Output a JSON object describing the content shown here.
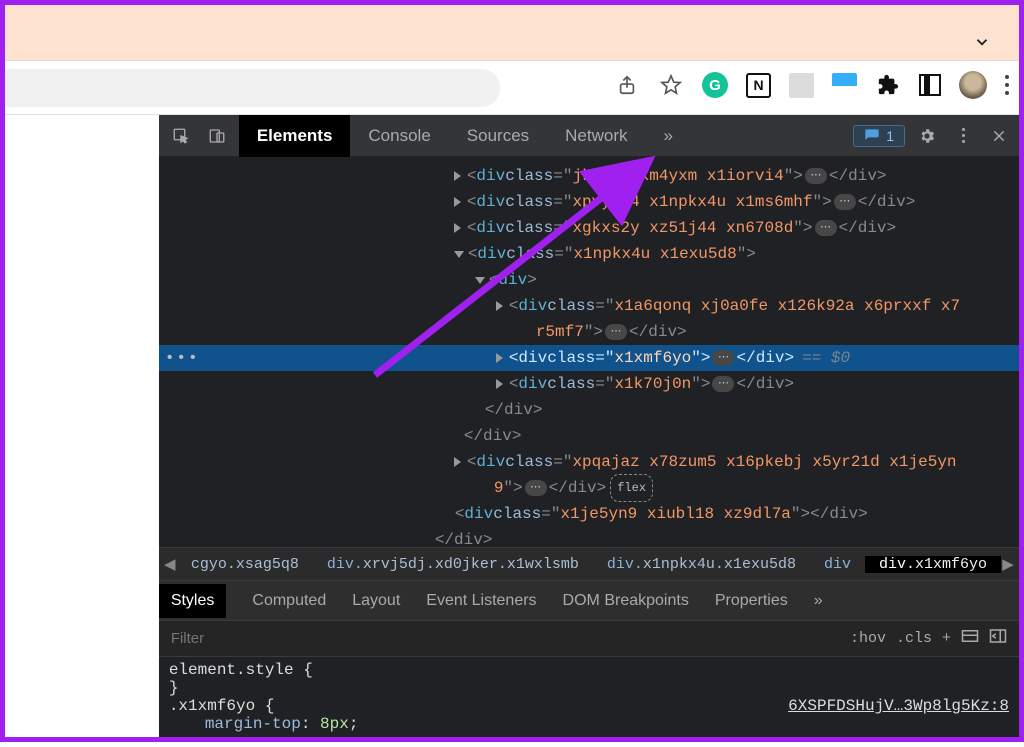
{
  "banner": {},
  "toolbar": {
    "notion_letter": "N",
    "green_letter": "G"
  },
  "devtools": {
    "tabs": [
      "Elements",
      "Console",
      "Sources",
      "Network"
    ],
    "issues_count": "1",
    "dom_lines": [
      {
        "indent": 295,
        "caret": "r",
        "pre": "<div class=\"",
        "val": "jkxs2y xm4yxm x1iorvi4",
        "post": "\">",
        "ell": true,
        "close": "</div>"
      },
      {
        "indent": 295,
        "caret": "r",
        "pre": "<div class=\"",
        "val": "xpvyfi4 x1npkx4u x1ms6mhf",
        "post": "\">",
        "ell": true,
        "close": "</div>"
      },
      {
        "indent": 295,
        "caret": "r",
        "pre": "<div class=\"",
        "val": "xgkxs2y xz51j44 xn6708d",
        "post": "\">",
        "ell": true,
        "close": "</div>"
      },
      {
        "indent": 295,
        "caret": "d",
        "pre": "<div class=\"",
        "val": "x1npkx4u x1exu5d8",
        "post": "\">",
        "close": ""
      },
      {
        "indent": 316,
        "caret": "d",
        "pre": "<div>",
        "val": "",
        "post": "",
        "close": ""
      },
      {
        "indent": 337,
        "caret": "r",
        "pre": "<div class=\"",
        "val": "x1a6qonq xj0a0fe x126k92a x6prxxf x7",
        "post": "",
        "close": "",
        "wrap": true
      },
      {
        "indent": 337,
        "caret": "",
        "pre2": "r5mf7",
        "post": "\">",
        "ell": true,
        "close": "</div>",
        "cont": true
      },
      {
        "indent": 337,
        "caret": "r",
        "pre": "<div class=\"",
        "val": "x1xmf6yo",
        "post": "\">",
        "ell": true,
        "close": "</div>",
        "selected": true,
        "eq0": " == $0"
      },
      {
        "indent": 337,
        "caret": "r",
        "pre": "<div class=\"",
        "val": "x1k70j0n",
        "post": "\">",
        "ell": true,
        "close": "</div>"
      },
      {
        "indent": 326,
        "text": "</div>"
      },
      {
        "indent": 305,
        "text": "</div>"
      },
      {
        "indent": 295,
        "caret": "r",
        "pre": "<div class=\"",
        "val": "xpqajaz x78zum5 x16pkebj x5yr21d x1je5yn",
        "post": "",
        "wrap": true
      },
      {
        "indent": 295,
        "caret": "",
        "pre2": "9",
        "post": "\">",
        "ell": true,
        "close": "</div>",
        "flex": true,
        "cont": true
      },
      {
        "indent": 296,
        "caret": "",
        "pre": "<div class=\"",
        "val": "x1je5yn9 xiubl18 xz9dl7a",
        "post": "\">",
        "close": "</div>"
      },
      {
        "indent": 276,
        "text": "</div>"
      }
    ],
    "crumbs": [
      {
        "label": "cgyo.xsag5q8",
        "prefix": ""
      },
      {
        "label": "xrvj5dj.xd0jker.x1wxlsmb",
        "prefix": "div."
      },
      {
        "label": "x1npkx4u.x1exu5d8",
        "prefix": "div."
      },
      {
        "label": "",
        "prefix": "div"
      },
      {
        "label": "x1xmf6yo",
        "prefix": "div.",
        "active": true
      }
    ],
    "styles_tabs": [
      "Styles",
      "Computed",
      "Layout",
      "Event Listeners",
      "DOM Breakpoints",
      "Properties"
    ],
    "filter_placeholder": "Filter",
    "hov": ":hov",
    "cls": ".cls",
    "style_lines": {
      "elStyle": "element.style {",
      "closeBrace": "}",
      "selector": ".x1xmf6yo {",
      "source": "6XSPFDSHujV…3Wp8lg5Kz:8",
      "prop": "margin-top",
      "val": "8px"
    }
  }
}
